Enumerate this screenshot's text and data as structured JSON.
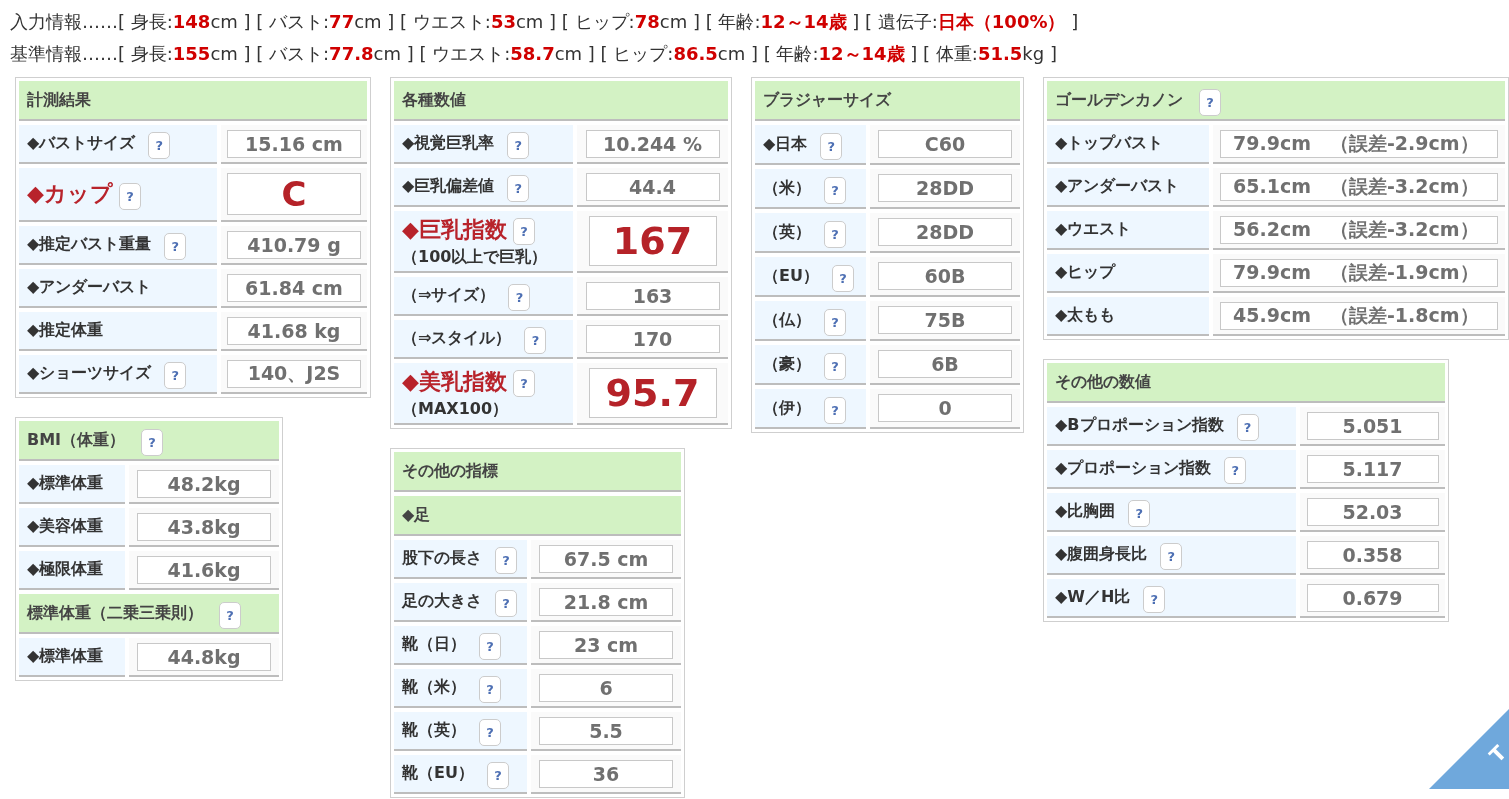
{
  "info_lines": [
    "入力情報……[ 身長:**148**cm ] [ バスト:**77**cm ] [ ウエスト:**53**cm ] [ ヒップ:**78**cm ] [ 年齢:**12～14歳** ] [ 遺伝子:**日本（100%）** ]",
    "基準情報……[ 身長:**155**cm ] [ バスト:**77.8**cm ] [ ウエスト:**58.7**cm ] [ ヒップ:**86.5**cm ] [ 年齢:**12～14歳** ] [ 体重:**51.5**kg ]"
  ],
  "panels": [
    {
      "title": "計測結果",
      "kind": "values",
      "rows": [
        {
          "kind": "item",
          "label": "◆バストサイズ",
          "help": "?",
          "value": "15.16 cm"
        },
        {
          "kind": "emphasis",
          "label": "◆カップ",
          "help": "?",
          "value": "C"
        },
        {
          "kind": "item",
          "label": "◆推定バスト重量",
          "help": "?",
          "value": "410.79 g"
        },
        {
          "kind": "item",
          "label": "◆アンダーバスト",
          "value": "61.84 cm"
        },
        {
          "kind": "item",
          "label": "◆推定体重",
          "value": "41.68 kg"
        },
        {
          "kind": "item",
          "label": "◆ショーツサイズ",
          "help": "?",
          "value": "140、J2S"
        }
      ]
    },
    {
      "title": "BMI（体重）",
      "help": "?",
      "kind": "values",
      "rows": [
        {
          "kind": "item",
          "label": "◆標準体重",
          "value": "48.2kg"
        },
        {
          "kind": "item",
          "label": "◆美容体重",
          "value": "43.8kg"
        },
        {
          "kind": "item",
          "label": "◆極限体重",
          "value": "41.6kg"
        },
        {
          "kind": "subheader",
          "label": "標準体重（二乗三乗則）",
          "help": "?"
        },
        {
          "kind": "item",
          "label": "◆標準体重",
          "value": "44.8kg"
        }
      ]
    },
    {
      "title": "各種数値",
      "kind": "values",
      "rows": [
        {
          "kind": "item",
          "label": "◆視覚巨乳率",
          "help": "?",
          "value": "10.244 %"
        },
        {
          "kind": "item",
          "label": "◆巨乳偏差値",
          "help": "?",
          "value": "44.4"
        },
        {
          "kind": "emphasis",
          "label": "◆巨乳指数",
          "help": "?",
          "note": "（100以上で巨乳）",
          "value": "167"
        },
        {
          "kind": "item",
          "label": "（⇒サイズ）",
          "help": "?",
          "value": "163"
        },
        {
          "kind": "item",
          "label": "（⇒スタイル）",
          "help": "?",
          "value": "170"
        },
        {
          "kind": "emphasis",
          "label": "◆美乳指数",
          "help": "?",
          "note": "（MAX100）",
          "value": "95.7"
        }
      ]
    },
    {
      "title": "その他の指標",
      "kind": "values",
      "rows": [
        {
          "kind": "subheader",
          "label": "◆足"
        },
        {
          "kind": "item",
          "label": "股下の長さ",
          "help": "?",
          "value": "67.5 cm"
        },
        {
          "kind": "item",
          "label": "足の大きさ",
          "help": "?",
          "value": "21.8 cm"
        },
        {
          "kind": "item",
          "label": "靴（日）",
          "help": "?",
          "value": "23 cm"
        },
        {
          "kind": "item",
          "label": "靴（米）",
          "help": "?",
          "value": "6"
        },
        {
          "kind": "item",
          "label": "靴（英）",
          "help": "?",
          "value": "5.5"
        },
        {
          "kind": "item",
          "label": "靴（EU）",
          "help": "?",
          "value": "36"
        }
      ]
    },
    {
      "title": "ブラジャーサイズ",
      "kind": "values",
      "rows": [
        {
          "kind": "item",
          "label": "◆日本",
          "help": "?",
          "value": "C60"
        },
        {
          "kind": "item",
          "label": "（米）",
          "help": "?",
          "value": "28DD"
        },
        {
          "kind": "item",
          "label": "（英）",
          "help": "?",
          "value": "28DD"
        },
        {
          "kind": "item",
          "label": "（EU）",
          "help": "?",
          "value": "60B"
        },
        {
          "kind": "item",
          "label": "（仏）",
          "help": "?",
          "value": "75B"
        },
        {
          "kind": "item",
          "label": "（豪）",
          "help": "?",
          "value": "6B"
        },
        {
          "kind": "item",
          "label": "（伊）",
          "help": "?",
          "value": "0"
        }
      ]
    },
    {
      "title": "ゴールデンカノン",
      "help": "?",
      "kind": "comparison",
      "rows": [
        {
          "kind": "item",
          "label": "◆トップバスト",
          "value": "79.9cm　（誤差-2.9cm）"
        },
        {
          "kind": "item",
          "label": "◆アンダーバスト",
          "value": "65.1cm　（誤差-3.2cm）"
        },
        {
          "kind": "item",
          "label": "◆ウエスト",
          "value": "56.2cm　（誤差-3.2cm）"
        },
        {
          "kind": "item",
          "label": "◆ヒップ",
          "value": "79.9cm　（誤差-1.9cm）"
        },
        {
          "kind": "item",
          "label": "◆太もも",
          "value": "45.9cm　（誤差-1.8cm）"
        }
      ]
    },
    {
      "title": "その他の数値",
      "kind": "values",
      "rows": [
        {
          "kind": "item",
          "label": "◆Bプロポーション指数",
          "help": "?",
          "value": "5.051"
        },
        {
          "kind": "item",
          "label": "◆プロポーション指数",
          "help": "?",
          "value": "5.117"
        },
        {
          "kind": "item",
          "label": "◆比胸囲",
          "help": "?",
          "value": "52.03"
        },
        {
          "kind": "item",
          "label": "◆腹囲身長比",
          "help": "?",
          "value": "0.358"
        },
        {
          "kind": "item",
          "label": "◆W／H比",
          "help": "?",
          "value": "0.679"
        }
      ]
    }
  ],
  "page_top_button": {
    "label": "T"
  }
}
